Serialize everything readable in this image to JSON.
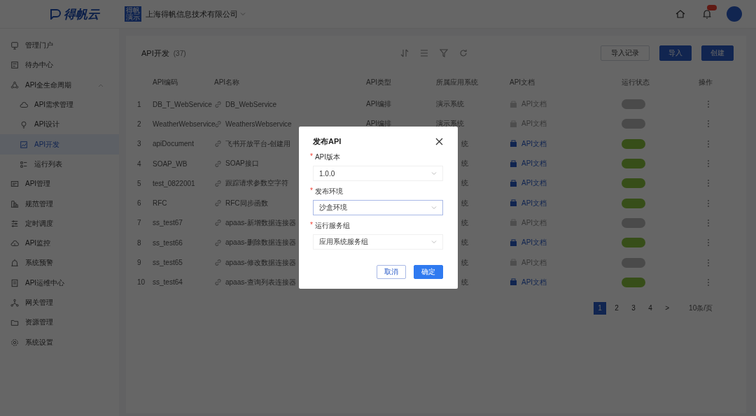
{
  "header": {
    "logo": "得帆云",
    "company_badge": "得帆演示",
    "company": "上海得帆信息技术有限公司"
  },
  "sidebar": {
    "items": [
      {
        "label": "管理门户",
        "selected": false
      },
      {
        "label": "待办中心",
        "selected": false
      },
      {
        "label": "API全生命周期",
        "selected": false,
        "expanded": true,
        "children": [
          {
            "label": "API需求管理",
            "selected": false
          },
          {
            "label": "API设计",
            "selected": false
          },
          {
            "label": "API开发",
            "selected": true
          },
          {
            "label": "运行列表",
            "selected": false
          }
        ]
      },
      {
        "label": "API管理",
        "selected": false
      },
      {
        "label": "规范管理",
        "selected": false
      },
      {
        "label": "定时调度",
        "selected": false
      },
      {
        "label": "API监控",
        "selected": false
      },
      {
        "label": "系统预警",
        "selected": false
      },
      {
        "label": "API运维中心",
        "selected": false
      },
      {
        "label": "网关管理",
        "selected": false
      },
      {
        "label": "资源管理",
        "selected": false
      },
      {
        "label": "系统设置",
        "selected": false
      }
    ]
  },
  "page": {
    "title": "API开发",
    "count": "(37)",
    "buttons": [
      {
        "label": "导入记录",
        "kind": "outline"
      },
      {
        "label": "导入",
        "kind": "primary"
      },
      {
        "label": "创建",
        "kind": "primary"
      }
    ]
  },
  "table": {
    "columns": [
      "API编码",
      "API名称",
      "API类型",
      "所属应用系统",
      "API文档",
      "运行状态",
      "操作"
    ],
    "rows": [
      {
        "index": "1",
        "code": "DB_T_WebService",
        "name": "DB_WebService",
        "api_type": "API编排",
        "app_system": "演示系统",
        "doc": "API文档",
        "doc_disabled": true,
        "running": false
      },
      {
        "index": "2",
        "code": "WeatherWebservice",
        "name": "WeathersWebservice",
        "api_type": "API编排",
        "app_system": "演示系统",
        "doc": "API文档",
        "doc_disabled": true,
        "running": false
      },
      {
        "index": "3",
        "code": "apiDocument",
        "name": "飞书开放平台-创建用",
        "app_system": "统",
        "doc": "API文档",
        "doc_disabled": false,
        "running": true
      },
      {
        "index": "4",
        "code": "SOAP_WB",
        "name": "SOAP接口",
        "app_system": "统",
        "doc": "API文档",
        "doc_disabled": false,
        "running": true
      },
      {
        "index": "5",
        "code": "test_0822001",
        "name": "跟踪请求参数空字符",
        "app_system": "统",
        "doc": "API文档",
        "doc_disabled": false,
        "running": true
      },
      {
        "index": "6",
        "code": "RFC",
        "name": "RFC同步函数",
        "app_system": "统",
        "doc": "API文档",
        "doc_disabled": false,
        "running": true
      },
      {
        "index": "7",
        "code": "ss_test67",
        "name": "apaas-新增数据连接器",
        "app_system": "统",
        "doc": "API文档",
        "doc_disabled": true,
        "running": false
      },
      {
        "index": "8",
        "code": "ss_test66",
        "name": "apaas-删除数据连接器",
        "app_system": "统",
        "doc": "API文档",
        "doc_disabled": false,
        "running": true
      },
      {
        "index": "9",
        "code": "ss_test65",
        "name": "apaas-修改数据连接器",
        "app_system": "统",
        "doc": "API文档",
        "doc_disabled": true,
        "running": false
      },
      {
        "index": "10",
        "code": "ss_test64",
        "name": "apaas-查询列表连接器",
        "app_system": "统",
        "doc": "API文档",
        "doc_disabled": false,
        "running": true
      }
    ]
  },
  "pagination": {
    "pages": [
      {
        "label": "1",
        "selected": true
      },
      {
        "label": "2",
        "selected": false
      },
      {
        "label": "3",
        "selected": false
      },
      {
        "label": "4",
        "selected": false
      }
    ],
    "next": ">",
    "page_size": "10条/页"
  },
  "dialog": {
    "title": "发布API",
    "fields": [
      {
        "marker": "*",
        "label": "API版本",
        "value": "1.0.0",
        "focused": false
      },
      {
        "marker": "*",
        "label": "发布环境",
        "value": "沙盒环境",
        "focused": true
      },
      {
        "marker": "*",
        "label": "运行服务组",
        "value": "应用系统服务组",
        "focused": false
      }
    ],
    "cancel": "取消",
    "confirm": "确定"
  }
}
